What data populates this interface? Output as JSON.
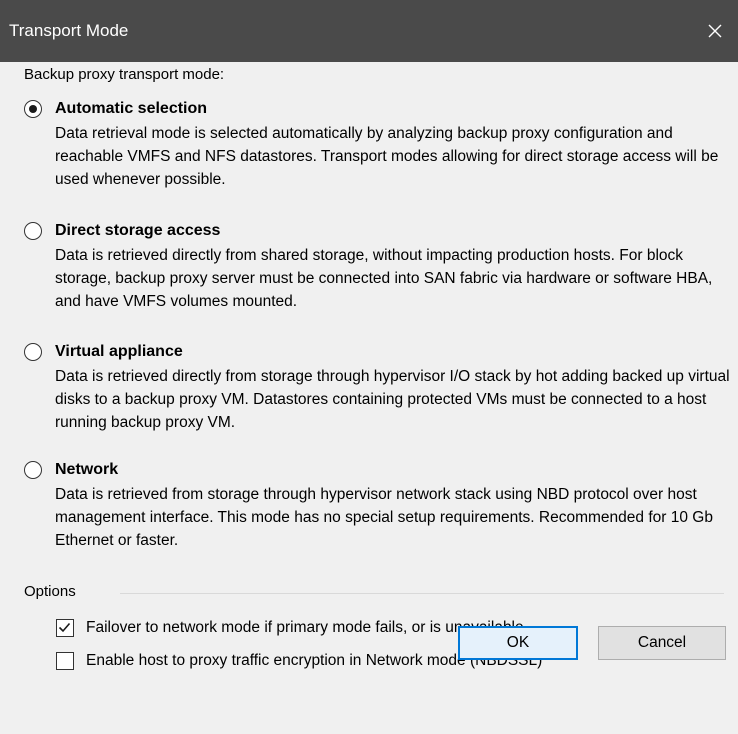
{
  "window": {
    "title": "Transport Mode",
    "close_icon": "close-icon"
  },
  "main": {
    "heading": "Backup proxy transport mode:",
    "modes": [
      {
        "label": "Automatic selection",
        "selected": true,
        "description": "Data retrieval mode is selected automatically by analyzing backup proxy configuration and reachable VMFS and NFS datastores. Transport modes allowing for direct storage access will be used whenever possible."
      },
      {
        "label": "Direct storage access",
        "selected": false,
        "description": "Data is retrieved directly from shared storage, without impacting production hosts. For block storage, backup proxy server must be connected into SAN fabric via hardware or software HBA, and have VMFS volumes mounted."
      },
      {
        "label": "Virtual appliance",
        "selected": false,
        "description": "Data is retrieved directly from storage through hypervisor I/O stack by hot adding backed up virtual disks to a backup proxy VM. Datastores containing protected VMs must be connected to a host running backup proxy VM."
      },
      {
        "label": "Network",
        "selected": false,
        "description": "Data is retrieved from storage through hypervisor network stack using NBD protocol over host management interface. This mode has no special setup requirements. Recommended for 10 Gb Ethernet or faster."
      }
    ]
  },
  "options": {
    "label": "Options",
    "items": [
      {
        "label": "Failover to network mode if primary mode fails, or is unavailable",
        "checked": true
      },
      {
        "label": "Enable host to proxy traffic encryption in Network mode (NBDSSL)",
        "checked": false
      }
    ]
  },
  "buttons": {
    "ok": "OK",
    "cancel": "Cancel"
  },
  "colors": {
    "titlebar": "#4a4a4a",
    "background": "#f0f0f0",
    "focus_border": "#0078d7"
  }
}
